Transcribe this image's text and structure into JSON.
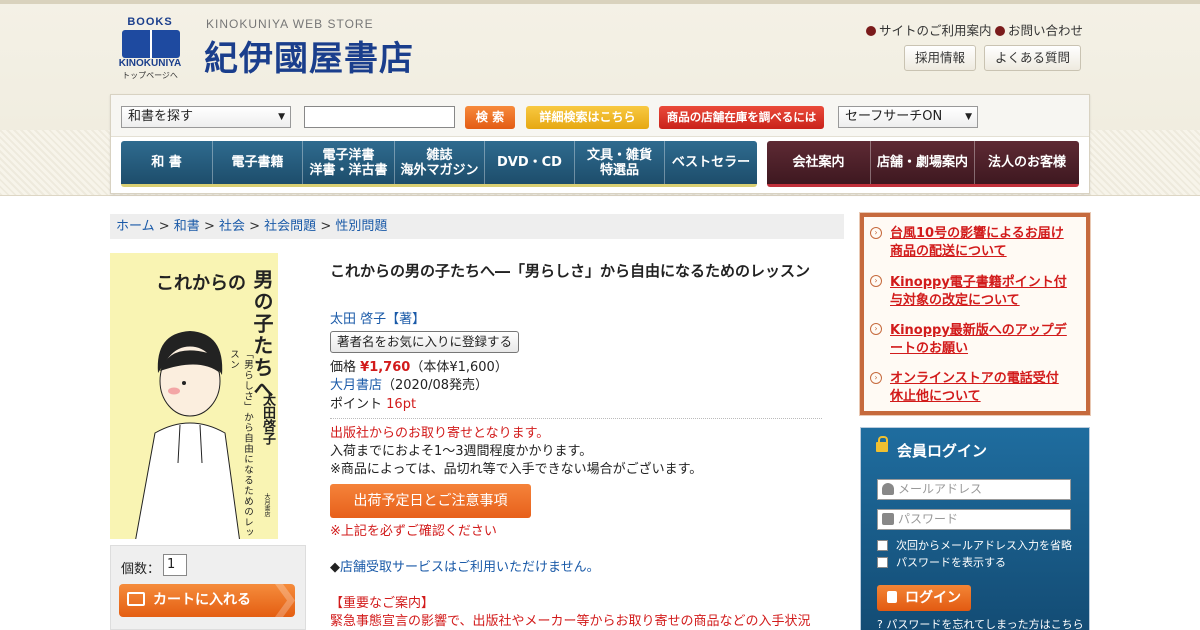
{
  "header": {
    "logo_books": "BOOKS",
    "logo_name": "KINOKUNIYA",
    "logo_top": "トップページへ",
    "store_en": "KINOKUNIYA WEB STORE",
    "store_jp": "紀伊國屋書店",
    "links": [
      "サイトのご利用案内",
      "お問い合わせ"
    ],
    "buttons": [
      "採用情報",
      "よくある質問"
    ]
  },
  "search": {
    "category_select": "和書を探す",
    "keyword_value": "",
    "search_button": "検 索",
    "advanced_button": "詳細検索はこちら",
    "stock_button": "商品の店舗在庫を調べるには",
    "safesearch_select": "セーフサーチON"
  },
  "nav": {
    "left": [
      "和 書",
      "電子書籍",
      "電子洋書\n洋書・洋古書",
      "雑誌\n海外マガジン",
      "DVD・CD",
      "文具・雑貨\n特選品",
      "ベストセラー"
    ],
    "right": [
      "会社案内",
      "店舗・劇場案内",
      "法人のお客様"
    ]
  },
  "breadcrumb": [
    "ホーム",
    "和書",
    "社会",
    "社会問題",
    "性別問題"
  ],
  "cover": {
    "title_a": "これからの",
    "title_b": "男の子たちへ",
    "subtitle": "「男らしさ」から自由になるためのレッスン",
    "author": "太田啓子",
    "publisher": "大月書店"
  },
  "product": {
    "title": "これからの男の子たちへ―「男らしさ」から自由になるためのレッスン",
    "author": "太田 啓子【著】",
    "fav_button": "著者名をお気に入りに登録する",
    "price_label": "価格",
    "price": "¥1,760",
    "price_note": "（本体¥1,600）",
    "publisher": "大月書店",
    "release": "（2020/08発売）",
    "point_label": "ポイント",
    "points": "16pt",
    "order_note": "出版社からのお取り寄せとなります。",
    "arrival": "入荷までにおよそ1～3週間程度かかります。",
    "availability": "※商品によっては、品切れ等で入手できない場合がございます。",
    "ship_button": "出荷予定日とご注意事項",
    "confirm_note": "※上記を必ずご確認ください",
    "store_pickup_mark": "◆",
    "store_pickup": "店舗受取サービスはご利用いただけません。",
    "notice_title": "【重要なご案内】",
    "notice_text": "緊急事態宣言の影響で、出版社やメーカー等からお取り寄せの商品などの入手状況"
  },
  "cart": {
    "qty_label": "個数：",
    "qty_value": "1",
    "cart_button": "カートに入れる"
  },
  "news": [
    "台風10号の影響によるお届け商品の配送について",
    "Kinoppy電子書籍ポイント付与対象の改定について",
    "Kinoppy最新版へのアップデートのお願い",
    "オンラインストアの電話受付休止他について"
  ],
  "login": {
    "title": "会員ログイン",
    "email_placeholder": "メールアドレス",
    "password_placeholder": "パスワード",
    "remember": "次回からメールアドレス入力を省略",
    "show_password": "パスワードを表示する",
    "login_button": "ログイン",
    "forgot": "パスワードを忘れてしまった方はこちら"
  },
  "colors": {
    "brand_blue": "#1a3e8c",
    "accent_orange": "#e7601b",
    "price_red": "#d21b1b",
    "nav_blue": "#1d4d6b",
    "nav_maroon": "#3e1820"
  }
}
